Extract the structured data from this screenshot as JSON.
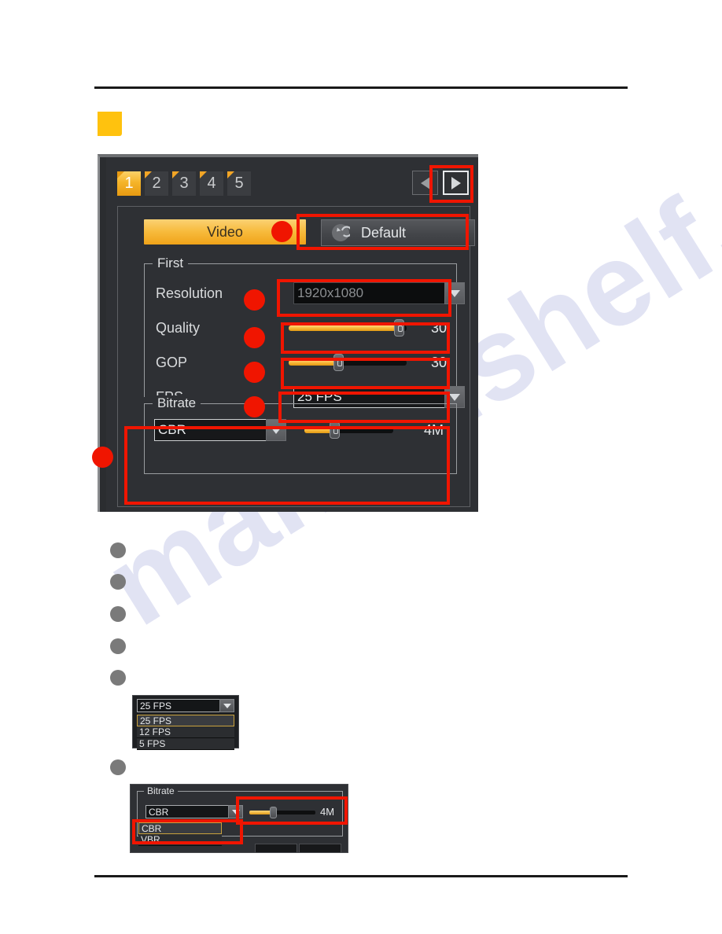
{
  "watermark": {
    "text": "manualshelf.com"
  },
  "panel": {
    "tabs": [
      {
        "label": "1",
        "active": true
      },
      {
        "label": "2",
        "active": false
      },
      {
        "label": "3",
        "active": false
      },
      {
        "label": "4",
        "active": false
      },
      {
        "label": "5",
        "active": false
      }
    ],
    "nav": {
      "prev_icon": "triangle-left-icon",
      "next_icon": "triangle-right-icon"
    },
    "video_button": "Video",
    "default_button": {
      "label": "Default",
      "icon": "reset-arrow-icon"
    },
    "first_group": {
      "legend": "First",
      "resolution": {
        "label": "Resolution",
        "value": "1920x1080",
        "disabled": true
      },
      "quality": {
        "label": "Quality",
        "value": "30",
        "percent": 85
      },
      "gop": {
        "label": "GOP",
        "value": "30",
        "percent": 42
      },
      "fps": {
        "label": "FPS",
        "value": "25 FPS"
      }
    },
    "bitrate_group": {
      "legend": "Bitrate",
      "mode": "CBR",
      "value": "4M",
      "percent": 33
    }
  },
  "fps_dropdown": {
    "selected": "25 FPS",
    "options": [
      "25 FPS",
      "12 FPS",
      "5 FPS"
    ]
  },
  "bitrate_dropdown": {
    "legend": "Bitrate",
    "selected": "CBR",
    "options": [
      "CBR",
      "VBR"
    ],
    "value": "4M",
    "percent": 33
  },
  "colors": {
    "accent_orange": "#f5b429",
    "annotation_red": "#f01500",
    "panel_bg": "#2e3034",
    "section_square": "#ffc20e"
  }
}
